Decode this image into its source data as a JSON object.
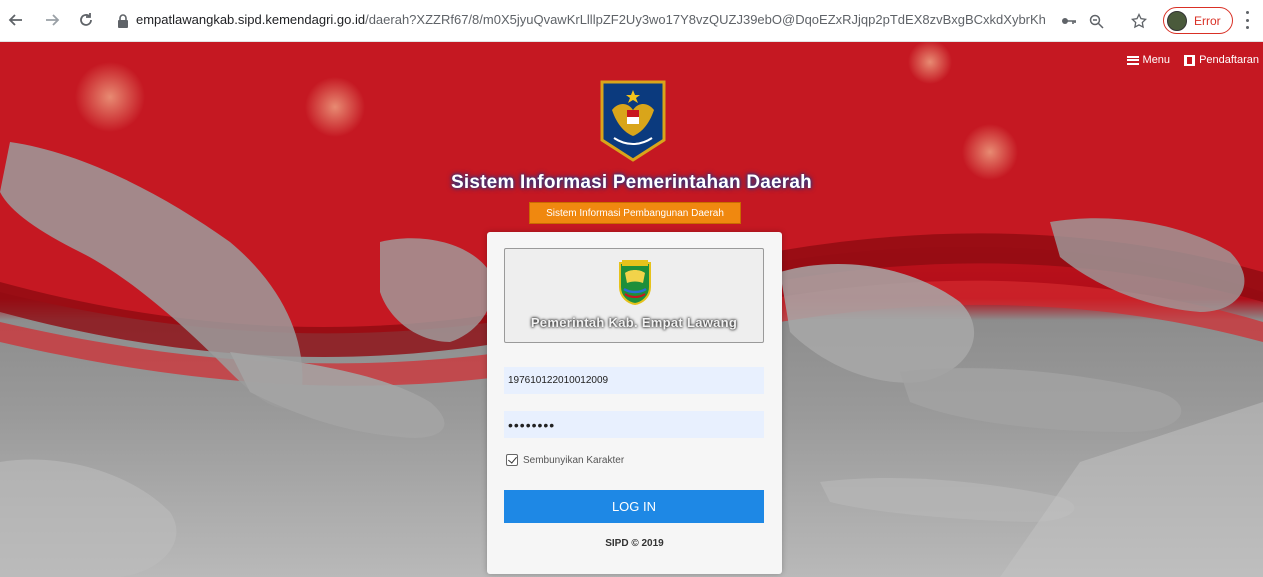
{
  "browser": {
    "url_host": "empatlawangkab.sipd.kemendagri.go.id",
    "url_path": "/daerah?XZZRf67/8/m0X5jyuQvawKrLlllpZF2Uy3wo17Y8vzQUZJ39ebO@DqoEZxRJjqp2pTdEX8zvBxgBCxkdXybrKhO7PSz...",
    "profile_status": "Error",
    "icons": [
      "back-arrow-icon",
      "forward-arrow-icon",
      "reload-icon",
      "lock-icon",
      "key-icon",
      "zoom-icon",
      "star-icon",
      "menu-kebab-icon"
    ]
  },
  "topnav": {
    "menu_label": "Menu",
    "register_label": "Pendaftaran"
  },
  "header": {
    "title": "Sistem Informasi Pemerintahan Daerah",
    "subtitle": "Sistem Informasi Pembangunan Daerah"
  },
  "login": {
    "region_name": "Pemerintah Kab. Empat Lawang",
    "username_value": "197610122010012009",
    "password_mask": "••••••••",
    "hide_chars_label": "Sembunyikan Karakter",
    "hide_chars_checked": true,
    "submit_label": "LOG IN",
    "footer": "SIPD © 2019"
  },
  "colors": {
    "accent_red": "#c81620",
    "orange": "#f0880f",
    "primary_blue": "#1e88e5",
    "error_red": "#d93025"
  }
}
